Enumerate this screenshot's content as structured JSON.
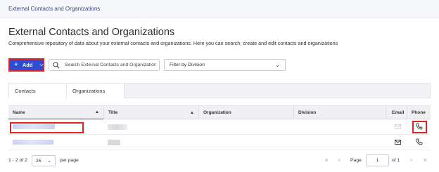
{
  "breadcrumb": "External Contacts and Organizations",
  "page": {
    "title": "External Contacts and Organizations",
    "subtitle": "Comprehensive repository of data about your external contacts and organizations. Here you can search, create and edit contacts and organizations"
  },
  "toolbar": {
    "add_label": "Add",
    "search_placeholder": "Search External Contacts and Organizations",
    "division_filter": "Filter by Division"
  },
  "tabs": [
    {
      "label": "Contacts",
      "active": true
    },
    {
      "label": "Organizations",
      "active": false
    }
  ],
  "table": {
    "columns": [
      "Name",
      "Title",
      "Organization",
      "Division",
      "Email",
      "Phone"
    ],
    "rows": [
      {
        "name": "",
        "title": "",
        "organization": "",
        "division": ""
      },
      {
        "name": "",
        "title": "",
        "organization": "",
        "division": ""
      }
    ]
  },
  "footer": {
    "range": "1 - 2 of 2",
    "page_size": "25",
    "per_page_label": "per page",
    "page_label": "Page",
    "current_page": "1",
    "of_label": "of 1"
  },
  "colors": {
    "accent": "#2f4bd2",
    "highlight": "#e22121"
  }
}
